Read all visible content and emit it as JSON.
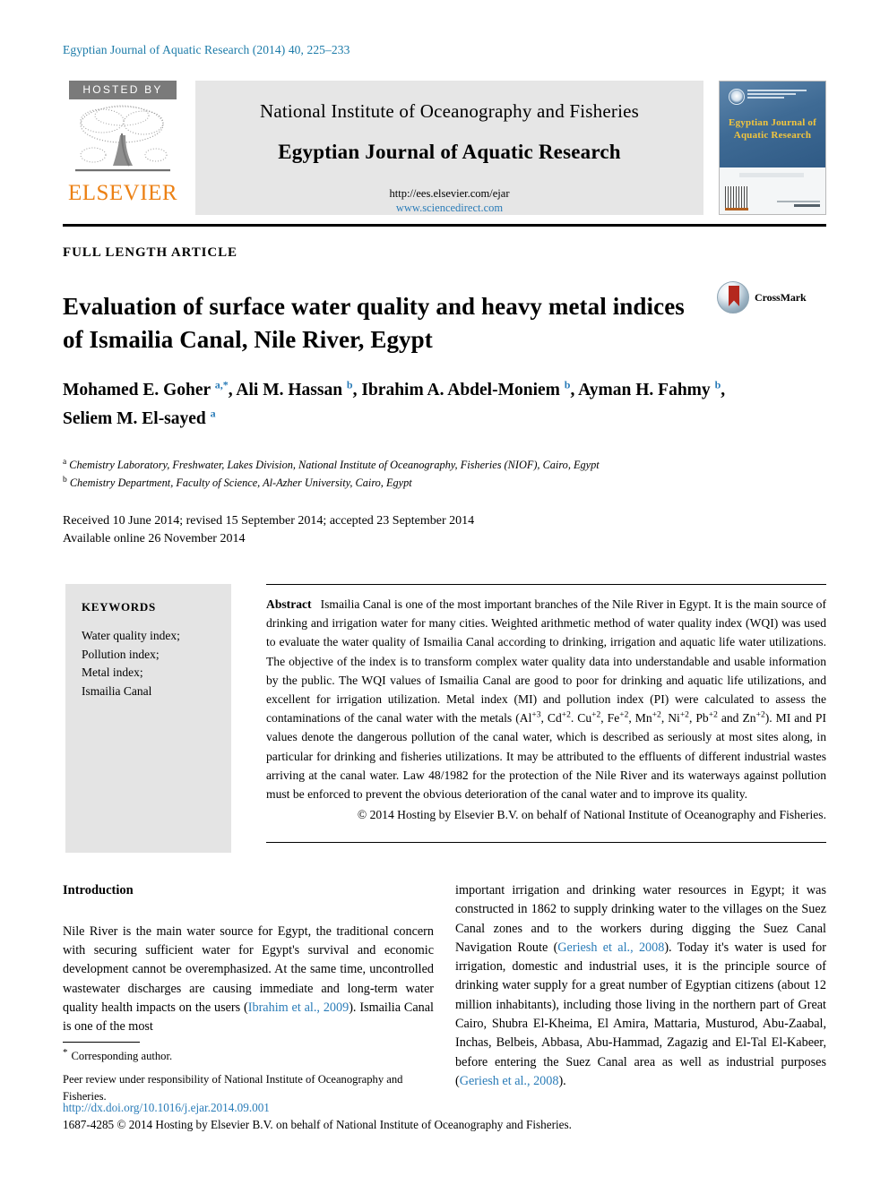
{
  "running_head": "Egyptian Journal of Aquatic Research (2014) 40, 225–233",
  "masthead": {
    "hosted_by": "HOSTED BY",
    "publisher": "ELSEVIER",
    "institute": "National Institute of Oceanography and Fisheries",
    "journal_title": "Egyptian Journal of Aquatic Research",
    "url_submission": "http://ees.elsevier.com/ejar",
    "url_sciencedirect": "www.sciencedirect.com",
    "cover": {
      "title_line1": "Egyptian Journal of",
      "title_line2": "Aquatic Research"
    }
  },
  "article": {
    "type": "FULL LENGTH ARTICLE",
    "title": "Evaluation of surface water quality and heavy metal indices of Ismailia Canal, Nile River, Egypt",
    "crossmark_label": "CrossMark",
    "authors_html": "Mohamed E. Goher <sup>a,*</sup>, Ali M. Hassan <sup>b</sup>, Ibrahim A. Abdel-Moniem <sup>b</sup>, Ayman H. Fahmy <sup>b</sup>, Seliem M. El-sayed <sup>a</sup>",
    "affiliations": [
      "a Chemistry Laboratory, Freshwater, Lakes Division, National Institute of Oceanography, Fisheries (NIOF), Cairo, Egypt",
      "b Chemistry Department, Faculty of Science, Al-Azher University, Cairo, Egypt"
    ],
    "history_line1": "Received 10 June 2014; revised 15 September 2014; accepted 23 September 2014",
    "history_line2": "Available online 26 November 2014"
  },
  "keywords": {
    "heading": "KEYWORDS",
    "items": [
      "Water quality index;",
      "Pollution index;",
      "Metal index;",
      "Ismailia Canal"
    ]
  },
  "abstract": {
    "label": "Abstract",
    "text_part1": "Ismailia Canal is one of the most important branches of the Nile River in Egypt. It is the main source of drinking and irrigation water for many cities. Weighted arithmetic method of water quality index (WQI) was used to evaluate the water quality of Ismailia Canal according to drinking, irrigation and aquatic life water utilizations. The objective of the index is to transform complex water quality data into understandable and usable information by the public. The WQI values of Ismailia Canal are good to poor for drinking and aquatic life utilizations, and excellent for irrigation utilization. Metal index (MI) and pollution index (PI) were calculated to assess the contaminations of the canal water with the metals (Al",
    "metal1": "+3",
    "metal1_sep": ", Cd",
    "metal2": "+2",
    "metal2_sep": ". Cu",
    "metal3": "+2",
    "metal3_sep": ", Fe",
    "metal4": "+2",
    "metal4_sep": ", Mn",
    "metal5": "+2",
    "metal5_sep": ", Ni",
    "metal6": "+2",
    "metal6_sep": ", Pb",
    "metal7": "+2",
    "metal7_sep": " and Zn",
    "metal8": "+2",
    "text_part2": "). MI and PI values denote the dangerous pollution of the canal water, which is described as seriously at most sites along, in particular for drinking and fisheries utilizations. It may be attributed to the effluents of different industrial wastes arriving at the canal water. Law 48/1982 for the protection of the Nile River and its waterways against pollution must be enforced to prevent the obvious deterioration of the canal water and to improve its quality.",
    "copyright": "© 2014 Hosting by Elsevier B.V. on behalf of National Institute of Oceanography and Fisheries."
  },
  "body": {
    "section_heading": "Introduction",
    "left_text_a": "Nile River is the main water source for Egypt, the traditional concern with securing sufficient water for Egypt's survival and economic development cannot be overemphasized. At the same time, uncontrolled wastewater discharges are causing immediate and long-term water quality health impacts on the users (",
    "left_ref1": "Ibrahim et al., 2009",
    "left_text_b": "). Ismailia Canal is one of the most",
    "right_text_a": "important irrigation and drinking water resources in Egypt; it was constructed in 1862 to supply drinking water to the villages on the Suez Canal zones and to the workers during digging the Suez Canal Navigation Route (",
    "right_ref1": "Geriesh et al., 2008",
    "right_text_b": "). Today it's water is used for irrigation, domestic and industrial uses, it is the principle source of drinking water supply for a great number of Egyptian citizens (about 12 million inhabitants), including those living in the northern part of Great Cairo, Shubra El-Kheima, El Amira, Mattaria, Musturod, Abu-Zaabal, Inchas, Belbeis, Abbasa, Abu-Hammad, Zagazig and El-Tal El-Kabeer, before entering the Suez Canal area as well as industrial purposes (",
    "right_ref2": "Geriesh et al., 2008",
    "right_text_c": ")."
  },
  "footnotes": {
    "corresponding": "Corresponding author.",
    "peer_review": "Peer review under responsibility of National Institute of Oceanography and Fisheries.",
    "doi": "http://dx.doi.org/10.1016/j.ejar.2014.09.001",
    "issn_line": "1687-4285 © 2014 Hosting by Elsevier B.V. on behalf of National Institute of Oceanography and Fisheries."
  },
  "colors": {
    "link_blue": "#2a7cb8",
    "header_blue": "#1a7aa8",
    "elsevier_orange": "#ec8013",
    "banner_gray": "#e6e6e6",
    "keywords_gray": "#e4e4e4",
    "crossmark_red": "#b4281e",
    "cover_yellow": "#f2c53d"
  }
}
